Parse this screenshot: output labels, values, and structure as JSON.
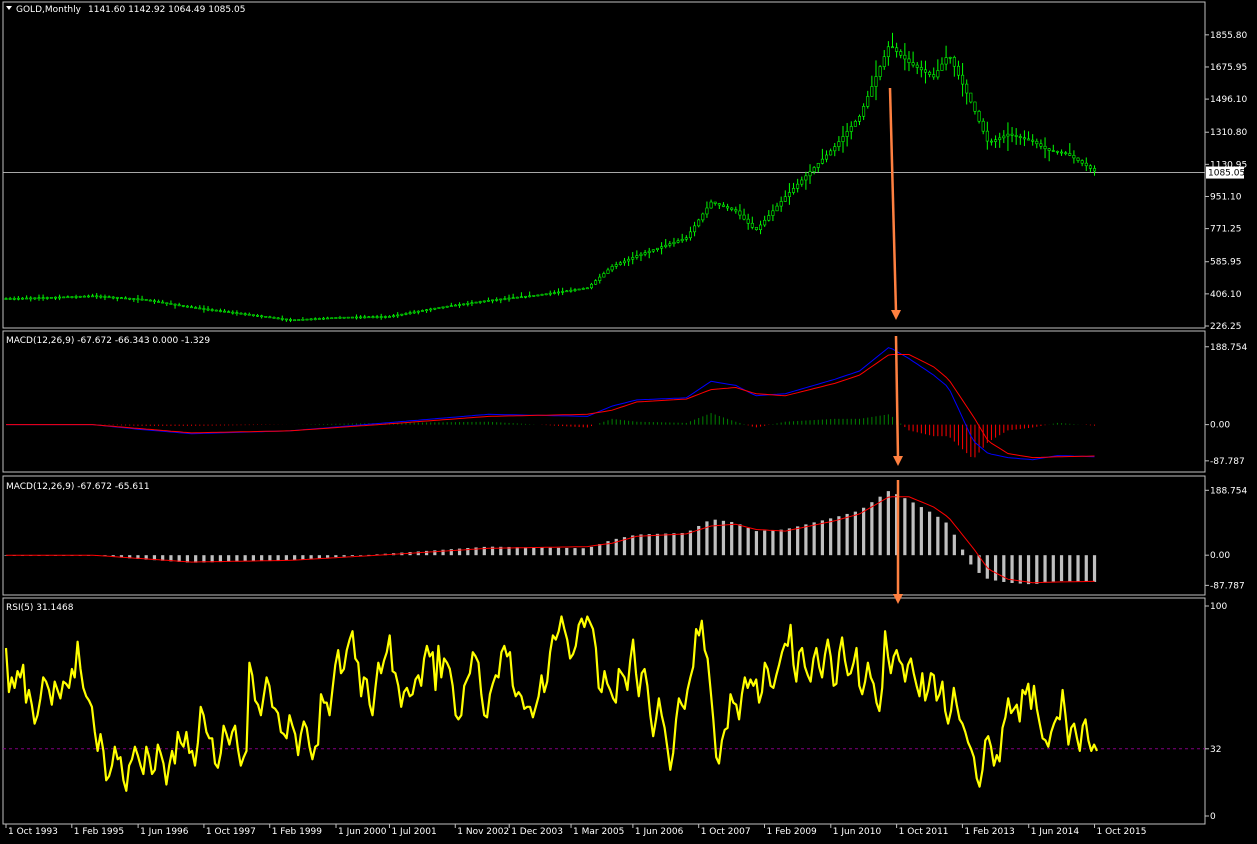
{
  "chart_data": [
    {
      "type": "candlestick",
      "title": "GOLD,Monthly",
      "ohlc_label": "1141.60 1142.92 1064.49 1085.05",
      "current_price_label": "1085.05",
      "current_price": 1085.05,
      "ylim": [
        226.25,
        1950
      ],
      "ticks": [
        {
          "v": 1855.8,
          "t": "1855.80"
        },
        {
          "v": 1675.95,
          "t": "1675.95"
        },
        {
          "v": 1496.1,
          "t": "1496.10"
        },
        {
          "v": 1310.8,
          "t": "1310.80"
        },
        {
          "v": 1130.95,
          "t": "1130.95"
        },
        {
          "v": 951.1,
          "t": "951.10"
        },
        {
          "v": 771.25,
          "t": "771.25"
        },
        {
          "v": 585.95,
          "t": "585.95"
        },
        {
          "v": 406.1,
          "t": "406.10"
        },
        {
          "v": 226.25,
          "t": "226.25"
        }
      ],
      "colors": {
        "candle": "#00ff00",
        "price_line": "#c0c0c0"
      },
      "close_anchors": [
        [
          1993.75,
          380
        ],
        [
          1994.5,
          385
        ],
        [
          1995.5,
          395
        ],
        [
          1996.5,
          375
        ],
        [
          1997.5,
          330
        ],
        [
          1998.5,
          295
        ],
        [
          1999.5,
          260
        ],
        [
          2000.5,
          275
        ],
        [
          2001.5,
          280
        ],
        [
          2002.5,
          330
        ],
        [
          2003.5,
          370
        ],
        [
          2004.5,
          400
        ],
        [
          2005.5,
          440
        ],
        [
          2006.0,
          560
        ],
        [
          2006.5,
          620
        ],
        [
          2007.5,
          720
        ],
        [
          2008.0,
          920
        ],
        [
          2008.5,
          870
        ],
        [
          2008.9,
          760
        ],
        [
          2009.5,
          950
        ],
        [
          2010.5,
          1230
        ],
        [
          2011.0,
          1400
        ],
        [
          2011.6,
          1800
        ],
        [
          2012.0,
          1700
        ],
        [
          2012.5,
          1620
        ],
        [
          2012.8,
          1750
        ],
        [
          2013.3,
          1450
        ],
        [
          2013.6,
          1250
        ],
        [
          2014.0,
          1300
        ],
        [
          2014.5,
          1260
        ],
        [
          2014.8,
          1210
        ],
        [
          2015.2,
          1190
        ],
        [
          2015.8,
          1085
        ]
      ]
    },
    {
      "type": "line",
      "title": "MACD(12,26,9) -67.672 -66.343 0.000 -1.329",
      "ylim": [
        -110,
        210
      ],
      "ticks": [
        {
          "v": 188.754,
          "t": "188.754"
        },
        {
          "v": 0,
          "t": "0.00"
        },
        {
          "v": -87.787,
          "t": "-87.787"
        }
      ],
      "series": [
        {
          "color": "#0000ff",
          "anchors": [
            [
              1993.75,
              0
            ],
            [
              1995.5,
              0
            ],
            [
              1996.5,
              -12
            ],
            [
              1997.5,
              -22
            ],
            [
              1999.5,
              -15
            ],
            [
              2001.5,
              5
            ],
            [
              2003.5,
              25
            ],
            [
              2005.5,
              20
            ],
            [
              2006.0,
              45
            ],
            [
              2006.5,
              60
            ],
            [
              2007.5,
              65
            ],
            [
              2008.0,
              105
            ],
            [
              2008.5,
              95
            ],
            [
              2008.9,
              70
            ],
            [
              2009.5,
              75
            ],
            [
              2010.5,
              110
            ],
            [
              2011.0,
              130
            ],
            [
              2011.6,
              188
            ],
            [
              2012.0,
              160
            ],
            [
              2012.5,
              120
            ],
            [
              2012.8,
              90
            ],
            [
              2013.3,
              -40
            ],
            [
              2013.6,
              -70
            ],
            [
              2014.0,
              -80
            ],
            [
              2014.5,
              -85
            ],
            [
              2015.0,
              -75
            ],
            [
              2015.8,
              -78
            ]
          ]
        },
        {
          "color": "#ff0000",
          "anchors": [
            [
              1993.75,
              0
            ],
            [
              1995.5,
              0
            ],
            [
              1996.5,
              -10
            ],
            [
              1997.5,
              -20
            ],
            [
              1999.5,
              -15
            ],
            [
              2001.5,
              2
            ],
            [
              2003.5,
              20
            ],
            [
              2005.5,
              25
            ],
            [
              2006.0,
              35
            ],
            [
              2006.5,
              55
            ],
            [
              2007.5,
              62
            ],
            [
              2008.0,
              85
            ],
            [
              2008.5,
              90
            ],
            [
              2008.9,
              75
            ],
            [
              2009.5,
              70
            ],
            [
              2010.5,
              100
            ],
            [
              2011.0,
              120
            ],
            [
              2011.6,
              170
            ],
            [
              2012.0,
              170
            ],
            [
              2012.5,
              140
            ],
            [
              2012.8,
              110
            ],
            [
              2013.3,
              20
            ],
            [
              2013.6,
              -40
            ],
            [
              2014.0,
              -70
            ],
            [
              2014.5,
              -80
            ],
            [
              2015.0,
              -78
            ],
            [
              2015.8,
              -76
            ]
          ]
        }
      ],
      "histogram_positive_color": "#008000",
      "histogram_negative_color": "#ff0000"
    },
    {
      "type": "bar",
      "title": "MACD(12,26,9) -67.672 -65.611",
      "ylim": [
        -110,
        210
      ],
      "ticks": [
        {
          "v": 188.754,
          "t": "188.754"
        },
        {
          "v": 0,
          "t": "0.00"
        },
        {
          "v": -87.787,
          "t": "-87.787"
        }
      ],
      "bar_color": "#c0c0c0",
      "signal_color": "#ff0000"
    },
    {
      "type": "line",
      "title": "RSI(5) 31.1468",
      "ylim": [
        0,
        100
      ],
      "level": 32,
      "level_color": "#800080",
      "ticks": [
        {
          "v": 100,
          "t": "100"
        },
        {
          "v": 32,
          "t": "32"
        },
        {
          "v": 0,
          "t": "0"
        }
      ],
      "color": "#ffff00",
      "values": [
        80,
        59,
        66,
        61,
        69,
        66,
        72,
        54,
        60,
        53,
        44,
        48,
        56,
        66,
        64,
        60,
        53,
        64,
        60,
        56,
        64,
        63,
        61,
        70,
        66,
        83,
        70,
        61,
        57,
        55,
        52,
        40,
        31,
        39,
        31,
        17,
        19,
        24,
        33,
        27,
        28,
        17,
        12,
        24,
        27,
        33,
        29,
        24,
        20,
        33,
        28,
        20,
        22,
        34,
        30,
        25,
        15,
        24,
        31,
        25,
        40,
        35,
        33,
        40,
        30,
        31,
        24,
        35,
        52,
        48,
        40,
        37,
        37,
        25,
        23,
        30,
        43,
        39,
        34,
        40,
        43,
        32,
        24,
        28,
        31,
        73,
        67,
        55,
        53,
        48,
        57,
        66,
        62,
        52,
        51,
        49,
        40,
        39,
        37,
        48,
        43,
        39,
        29,
        39,
        45,
        42,
        33,
        27,
        33,
        34,
        58,
        54,
        54,
        48,
        60,
        72,
        79,
        68,
        70,
        79,
        84,
        88,
        75,
        73,
        57,
        66,
        65,
        53,
        48,
        61,
        73,
        68,
        74,
        78,
        86,
        69,
        68,
        62,
        52,
        59,
        61,
        57,
        58,
        65,
        67,
        62,
        75,
        81,
        76,
        78,
        60,
        81,
        66,
        75,
        73,
        70,
        62,
        48,
        46,
        48,
        62,
        65,
        68,
        78,
        76,
        73,
        58,
        48,
        47,
        58,
        63,
        67,
        66,
        78,
        81,
        76,
        78,
        62,
        57,
        59,
        57,
        51,
        52,
        52,
        47,
        52,
        57,
        67,
        59,
        64,
        78,
        86,
        84,
        88,
        95,
        89,
        84,
        75,
        77,
        81,
        91,
        94,
        90,
        95,
        92,
        89,
        80,
        61,
        59,
        69,
        63,
        60,
        56,
        54,
        70,
        68,
        66,
        60,
        74,
        84,
        68,
        57,
        68,
        70,
        62,
        48,
        38,
        46,
        56,
        48,
        42,
        32,
        22,
        30,
        46,
        56,
        53,
        51,
        60,
        66,
        71,
        89,
        86,
        93,
        79,
        75,
        61,
        46,
        28,
        25,
        36,
        41,
        42,
        58,
        54,
        53,
        46,
        58,
        66,
        61,
        65,
        62,
        65,
        54,
        59,
        73,
        70,
        62,
        61,
        67,
        72,
        78,
        82,
        81,
        91,
        72,
        64,
        78,
        80,
        71,
        67,
        64,
        75,
        80,
        71,
        66,
        77,
        84,
        76,
        62,
        63,
        78,
        85,
        74,
        67,
        68,
        73,
        80,
        62,
        58,
        64,
        73,
        66,
        63,
        54,
        50,
        61,
        88,
        76,
        68,
        76,
        79,
        74,
        72,
        64,
        72,
        75,
        68,
        62,
        57,
        68,
        55,
        60,
        68,
        67,
        55,
        58,
        64,
        50,
        44,
        50,
        61,
        53,
        46,
        44,
        40,
        35,
        32,
        28,
        18,
        14,
        22,
        36,
        38,
        33,
        24,
        29,
        26,
        42,
        47,
        56,
        49,
        51,
        53,
        45,
        60,
        58,
        63,
        51,
        62,
        51,
        44,
        37,
        36,
        33,
        40,
        44,
        47,
        46,
        60,
        48,
        34,
        42,
        44,
        37,
        31,
        43,
        46,
        36,
        31,
        34,
        31
      ]
    }
  ],
  "x_axis": {
    "labels": [
      {
        "v": 1993.75,
        "t": "1 Oct 1993"
      },
      {
        "v": 1995.08,
        "t": "1 Feb 1995"
      },
      {
        "v": 1996.42,
        "t": "1 Jun 1996"
      },
      {
        "v": 1997.75,
        "t": "1 Oct 1997"
      },
      {
        "v": 1999.08,
        "t": "1 Feb 1999"
      },
      {
        "v": 2000.42,
        "t": "1 Jun 2000"
      },
      {
        "v": 2001.5,
        "t": "1 Jul 2001"
      },
      {
        "v": 2002.83,
        "t": "1 Nov 2002"
      },
      {
        "v": 2003.92,
        "t": "1 Dec 2003"
      },
      {
        "v": 2005.17,
        "t": "1 Mar 2005"
      },
      {
        "v": 2006.42,
        "t": "1 Jun 2006"
      },
      {
        "v": 2007.75,
        "t": "1 Oct 2007"
      },
      {
        "v": 2009.08,
        "t": "1 Feb 2009"
      },
      {
        "v": 2010.42,
        "t": "1 Jun 2010"
      },
      {
        "v": 2011.75,
        "t": "1 Oct 2011"
      },
      {
        "v": 2013.08,
        "t": "1 Feb 2013"
      },
      {
        "v": 2014.42,
        "t": "1 Jun 2014"
      },
      {
        "v": 2015.75,
        "t": "1 Oct 2015"
      }
    ]
  },
  "annotation": {
    "color": "#ff8040"
  }
}
